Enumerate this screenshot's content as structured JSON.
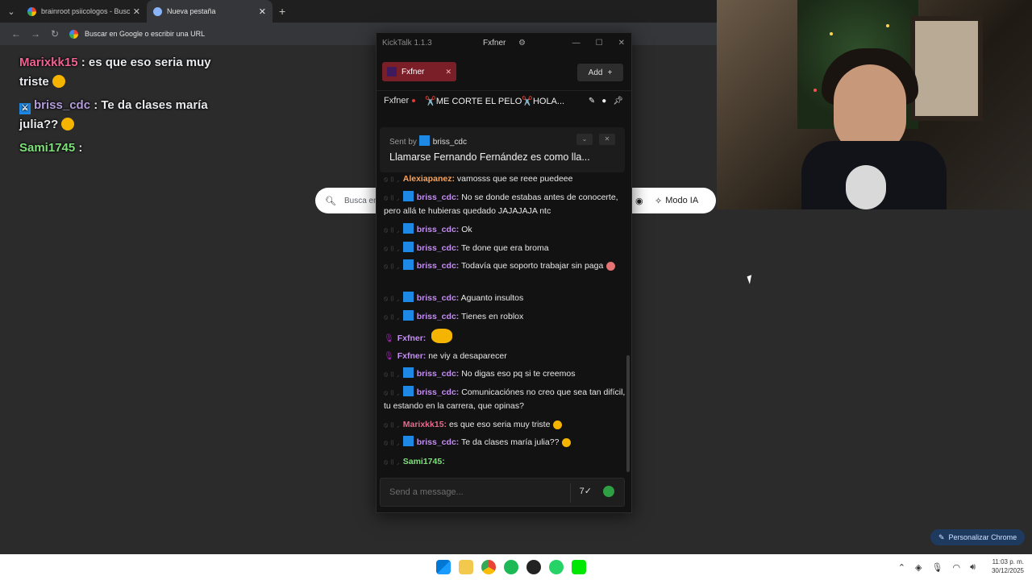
{
  "browser": {
    "tabs": [
      {
        "title": "brainroot psiicologos - Buscar c"
      },
      {
        "title": "Nueva pestaña"
      }
    ],
    "omnibox_placeholder": "Buscar en Google o escribir una URL",
    "search_placeholder": "Busca en",
    "ai_mode_label": "Modo IA",
    "customize_label": "Personalizar Chrome"
  },
  "overlay": {
    "lines": [
      {
        "user": "Marixkk15",
        "text": " : es que eso seria muy triste"
      },
      {
        "user": "briss_cdc",
        "text": " : Te da clases maría julia??"
      },
      {
        "user": "Sami1745",
        "text": " :"
      }
    ]
  },
  "kicktalk": {
    "app_title": "KickTalk 1.1.3",
    "current_user": "Fxfner",
    "channel_tab": "Fxfner",
    "add_label": "Add",
    "channel_name": "Fxfner",
    "stream_title": "✂️ME CORTE EL PELO✂️HOLA...",
    "pinned": {
      "sent_by_label": "Sent by",
      "user": "briss_cdc",
      "message": "Llamarse Fernando Fernández es como lla..."
    },
    "messages": [
      {
        "user": "Alexiapanez:",
        "text": "vamosss que se reee puedeee",
        "style": "orange"
      },
      {
        "user": "briss_cdc:",
        "text": "No se donde estabas antes de conocerte, pero allá te hubieras quedado JAJAJAJA ntc",
        "style": "purple"
      },
      {
        "user": "briss_cdc:",
        "text": "Ok",
        "style": "purple"
      },
      {
        "user": "briss_cdc:",
        "text": "Te done que era broma",
        "style": "purple"
      },
      {
        "user": "briss_cdc:",
        "text": "Todavía que soporto trabajar sin paga",
        "style": "purple"
      },
      {
        "user": "briss_cdc:",
        "text": "Aguanto insultos",
        "style": "purple"
      },
      {
        "user": "briss_cdc:",
        "text": "Tienes en roblox",
        "style": "purple"
      },
      {
        "user": "Fxfner:",
        "text": "",
        "style": "purple"
      },
      {
        "user": "Fxfner:",
        "text": "ne viy a desaparecer",
        "style": "purple"
      },
      {
        "user": "briss_cdc:",
        "text": "No digas eso pq si te creemos",
        "style": "purple"
      },
      {
        "user": "briss_cdc:",
        "text": "Comunicaciónes no creo que sea tan difícil, tu estando en la carrera, que opinas?",
        "style": "purple"
      },
      {
        "user": "Marixkk15:",
        "text": "es que eso seria muy triste",
        "style": "pink"
      },
      {
        "user": "briss_cdc:",
        "text": "Te da clases maría julia??",
        "style": "purple"
      },
      {
        "user": "Sami1745:",
        "text": "",
        "style": "green"
      }
    ],
    "input_placeholder": "Send a message..."
  },
  "taskbar": {
    "time": "11:03 p. m.",
    "date": "30/12/2025"
  },
  "colors": {
    "accent_tab": "#7a1f28",
    "kick_green": "#2ea043",
    "badge_blue": "#1e88e5"
  }
}
